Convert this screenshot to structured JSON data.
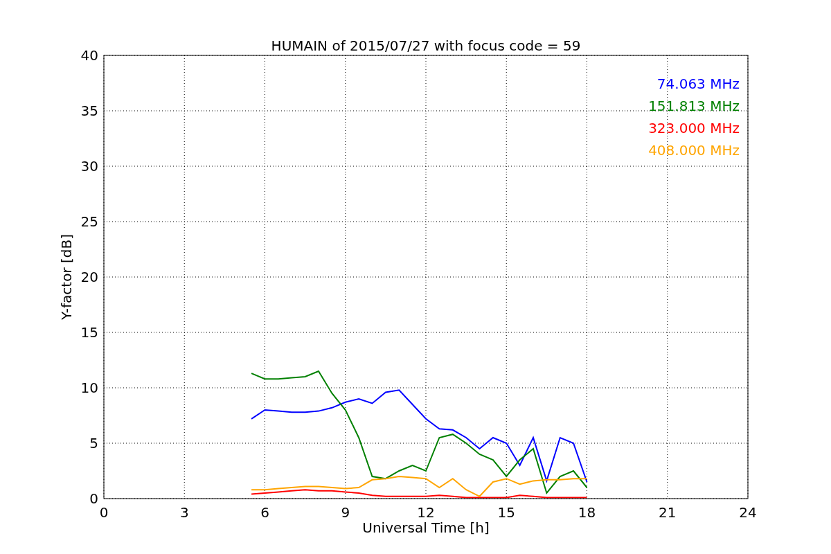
{
  "chart_data": {
    "type": "line",
    "title": "HUMAIN of 2015/07/27 with focus code = 59",
    "xlabel": "Universal Time [h]",
    "ylabel": "Y-factor [dB]",
    "x": [
      5.5,
      6,
      6.5,
      7,
      7.5,
      8,
      8.5,
      9,
      9.5,
      10,
      10.5,
      11,
      11.5,
      12,
      12.5,
      13,
      13.5,
      14,
      14.5,
      15,
      15.5,
      16,
      16.5,
      17,
      17.5,
      18
    ],
    "series": [
      {
        "name": "74.063 MHz",
        "color": "#0000ff",
        "values": [
          7.2,
          8.0,
          7.9,
          7.8,
          7.8,
          7.9,
          8.2,
          8.7,
          9.0,
          8.6,
          9.6,
          9.8,
          8.5,
          7.2,
          6.3,
          6.2,
          5.5,
          4.5,
          5.5,
          5.0,
          3.0,
          5.5,
          1.6,
          5.5,
          5.0,
          1.5
        ]
      },
      {
        "name": "151.813 MHz",
        "color": "#008000",
        "values": [
          11.3,
          10.8,
          10.8,
          10.9,
          11.0,
          11.5,
          9.5,
          8.0,
          5.5,
          2.0,
          1.8,
          2.5,
          3.0,
          2.5,
          5.5,
          5.8,
          5.0,
          4.0,
          3.5,
          2.0,
          3.5,
          4.5,
          0.5,
          2.0,
          2.5,
          1.0
        ]
      },
      {
        "name": "323.000 MHz",
        "color": "#ff0000",
        "values": [
          0.4,
          0.5,
          0.6,
          0.7,
          0.8,
          0.7,
          0.7,
          0.6,
          0.5,
          0.3,
          0.2,
          0.2,
          0.2,
          0.2,
          0.3,
          0.2,
          0.1,
          0.1,
          0.1,
          0.1,
          0.3,
          0.2,
          0.1,
          0.1,
          0.1,
          0.1
        ]
      },
      {
        "name": "408.000 MHz",
        "color": "#ffa500",
        "values": [
          0.8,
          0.8,
          0.9,
          1.0,
          1.1,
          1.1,
          1.0,
          0.9,
          1.0,
          1.7,
          1.8,
          2.0,
          1.9,
          1.8,
          1.0,
          1.8,
          0.8,
          0.2,
          1.5,
          1.8,
          1.3,
          1.6,
          1.7,
          1.7,
          1.8,
          1.8
        ]
      }
    ],
    "grid": true,
    "xlim": [
      0,
      24
    ],
    "ylim": [
      0,
      40
    ],
    "xticks": [
      0,
      3,
      6,
      9,
      12,
      15,
      18,
      21,
      24
    ],
    "yticks": [
      0,
      5,
      10,
      15,
      20,
      25,
      30,
      35,
      40
    ]
  }
}
